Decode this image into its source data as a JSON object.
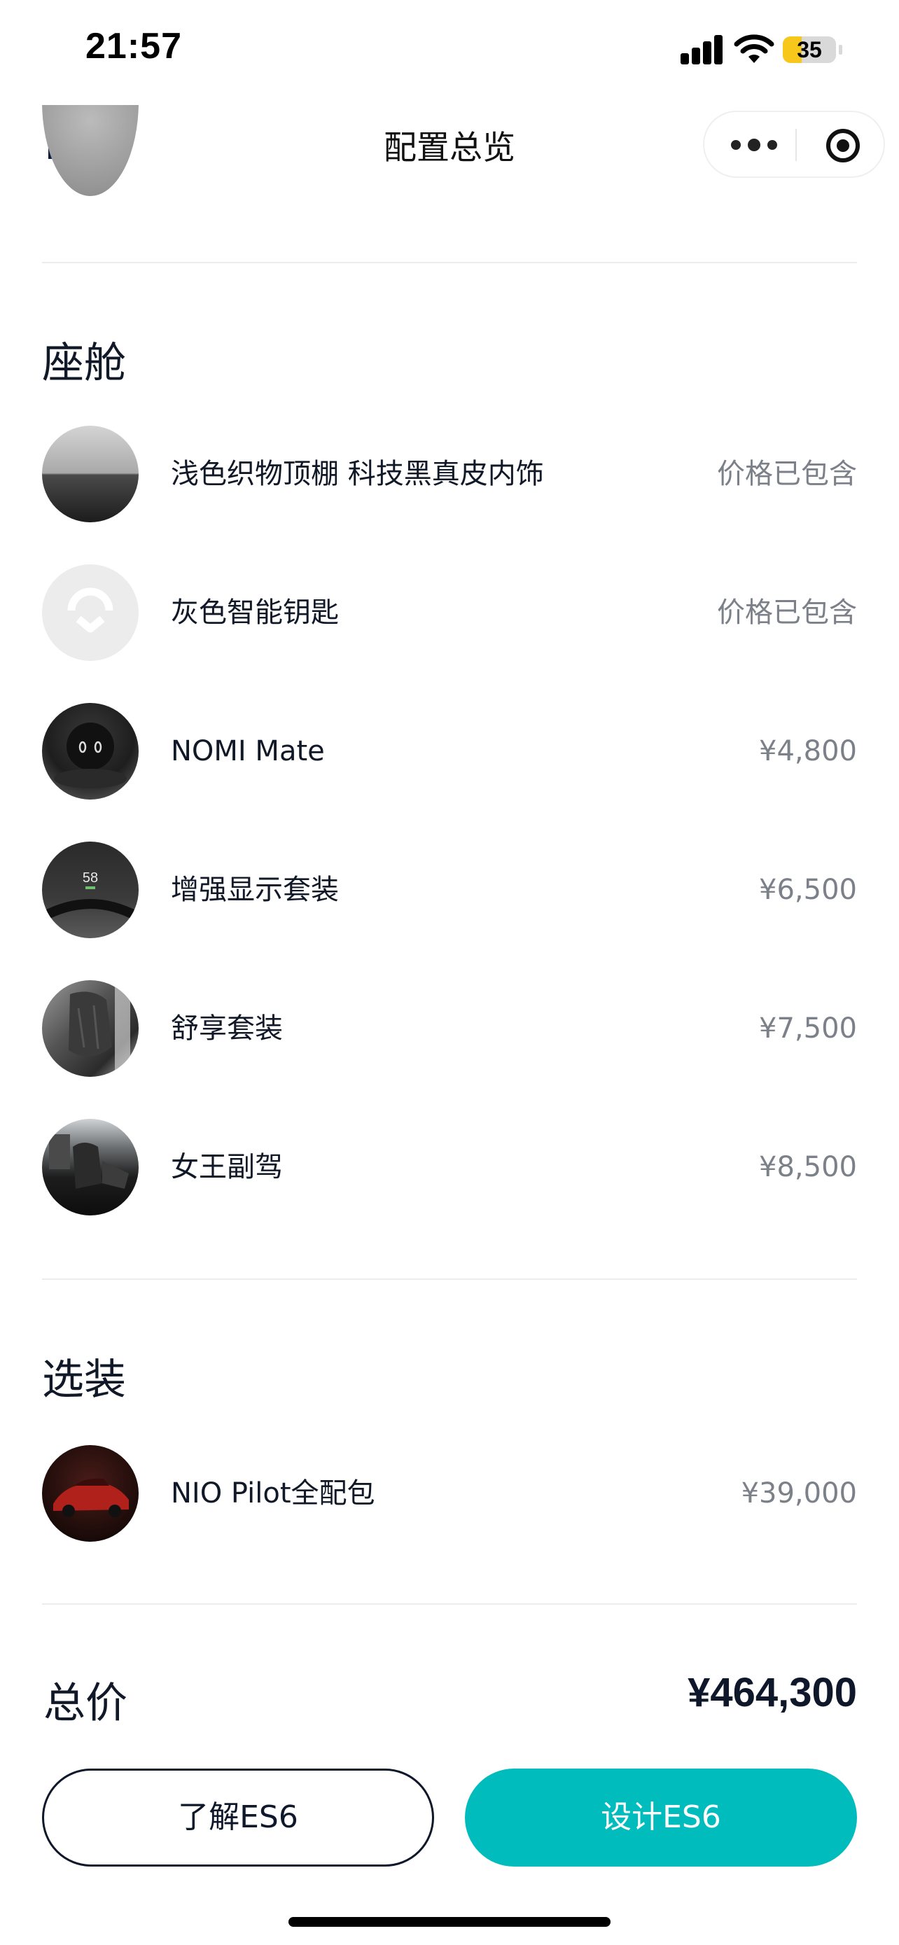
{
  "status_bar": {
    "time": "21:57",
    "battery": "35",
    "battery_color": "#f7c71b"
  },
  "nav": {
    "title": "配置总览",
    "home_icon": "home-icon",
    "more_icon": "more-dots-icon",
    "target_icon": "target-icon"
  },
  "sections": {
    "cabin": {
      "title": "座舱",
      "items": [
        {
          "label": "浅色织物顶棚 科技黑真皮内饰",
          "price": "价格已包含"
        },
        {
          "label": "灰色智能钥匙",
          "price": "价格已包含"
        },
        {
          "label": "NOMI Mate",
          "price": "¥4,800"
        },
        {
          "label": "增强显示套装",
          "price": "¥6,500"
        },
        {
          "label": "舒享套装",
          "price": "¥7,500"
        },
        {
          "label": "女王副驾",
          "price": "¥8,500"
        }
      ]
    },
    "options": {
      "title": "选装",
      "items": [
        {
          "label": "NIO Pilot全配包",
          "price": "¥39,000"
        }
      ]
    }
  },
  "hud_thumb_number": "58",
  "total": {
    "label": "总价",
    "value": "¥464,300"
  },
  "buttons": {
    "learn": "了解ES6",
    "design": "设计ES6"
  },
  "colors": {
    "accent": "#00bcbc",
    "primary_text": "#111827",
    "secondary_text": "#7c8088"
  }
}
